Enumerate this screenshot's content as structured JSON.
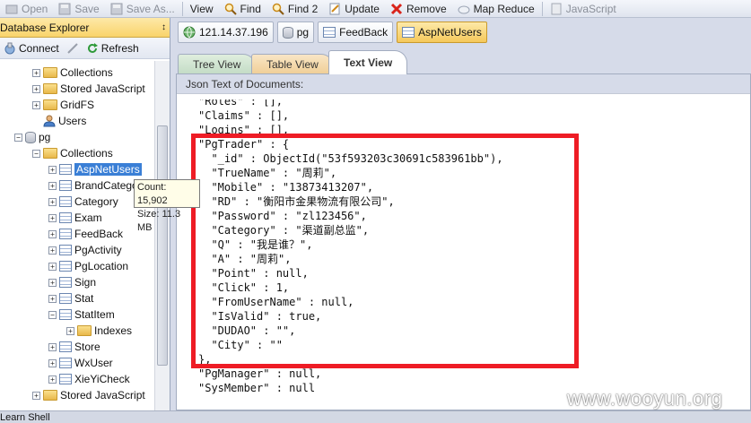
{
  "toolbar": {
    "open": "Open",
    "save": "Save",
    "save_as": "Save As...",
    "view": "View",
    "find": "Find",
    "find2": "Find 2",
    "update": "Update",
    "remove": "Remove",
    "map_reduce": "Map Reduce",
    "javascript": "JavaScript"
  },
  "explorer": {
    "title": "Database Explorer",
    "pin": "↕",
    "connect": "Connect",
    "refresh": "Refresh",
    "tree": {
      "collections_top": "Collections",
      "stored_js_top": "Stored JavaScript",
      "gridfs": "GridFS",
      "users": "Users",
      "pg": "pg",
      "collections": "Collections",
      "items": [
        "AspNetUsers",
        "BrandCategory",
        "Category",
        "Exam",
        "FeedBack",
        "PgActivity",
        "PgLocation",
        "Sign",
        "Stat",
        "StatItem",
        "Indexes",
        "Store",
        "WxUser",
        "XieYiCheck"
      ],
      "stored_js": "Stored JavaScript"
    },
    "tooltip": {
      "count": "Count: 15,902",
      "size": "Size: 11.3 MB"
    }
  },
  "connection": {
    "server": "121.14.37.196",
    "db": "pg",
    "collection_a": "FeedBack",
    "collection_b": "AspNetUsers"
  },
  "tabs": {
    "tree_view": "Tree View",
    "table_view": "Table View",
    "text_view": "Text View"
  },
  "panel": {
    "title": "Json Text of Documents:",
    "lines": [
      "\"Roles\" : [],",
      "\"Claims\" : [],",
      "\"Logins\" : [],",
      "\"PgTrader\" : {",
      "  \"_id\" : ObjectId(\"53f593203c30691c583961bb\"),",
      "  \"TrueName\" : \"周莉\",",
      "  \"Mobile\" : \"13873413207\",",
      "  \"RD\" : \"衡阳市金果物流有限公司\",",
      "  \"Password\" : \"zl123456\",",
      "  \"Category\" : \"渠道副总监\",",
      "  \"Q\" : \"我是谁？\",",
      "  \"A\" : \"周莉\",",
      "  \"Point\" : null,",
      "  \"Click\" : 1,",
      "  \"FromUserName\" : null,",
      "  \"IsValid\" : true,",
      "  \"DUDAO\" : \"\",",
      "  \"City\" : \"\"",
      "},",
      "\"PgManager\" : null,",
      "\"SysMember\" : null"
    ]
  },
  "status": {
    "text": "Learn Shell"
  },
  "watermark": "www.wooyun.org",
  "colors": {
    "highlight_box": "#ee1c25",
    "selection": "#3a7fd6"
  }
}
